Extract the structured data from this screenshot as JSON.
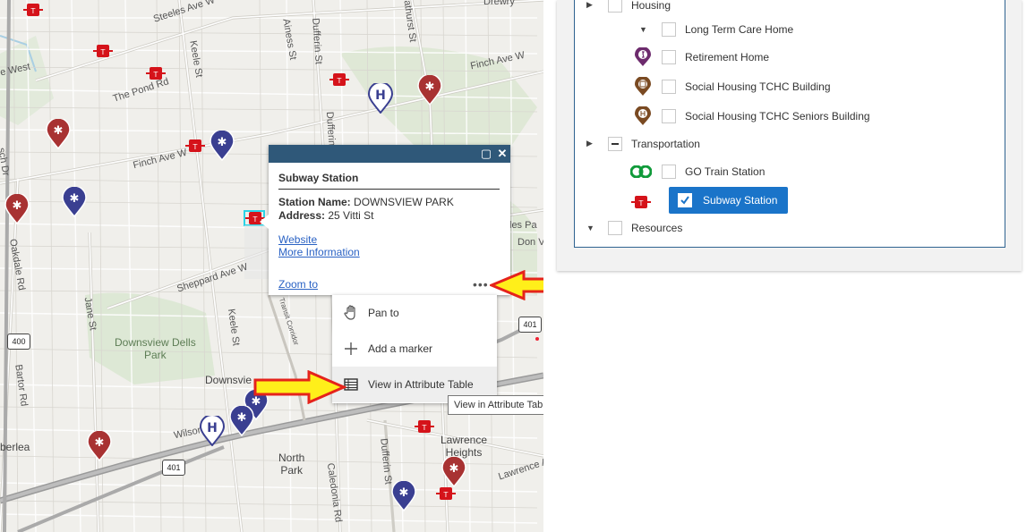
{
  "map": {
    "streets": {
      "steeles": "Steeles Ave W",
      "keele_top": "Keele St",
      "ainess": "Ainess St",
      "dufferin_top": "Dufferin St",
      "bathurst": "Bathurst St",
      "drewry": "Drewry",
      "finch_e": "Finch Ave W",
      "finch_w": "Finch Ave W",
      "pond": "The Pond Rd",
      "west": "e West",
      "oakdale": "Oakdale Rd",
      "jane": "Jane St",
      "sheppard": "Sheppard Ave W",
      "keele_mid": "Keele St",
      "dufferin_mid": "Dufferin",
      "wilson": "Wilson",
      "bartor": "Bartor Rd",
      "caledonia": "Caledonia Rd",
      "dufferin_bot": "Dufferin St",
      "lawrence": "Lawrence Ave W",
      "don_v": "Don V",
      "les_pa": "les Pa",
      "berlea": "berlea",
      "sth_dr": "sch Dr",
      "downsview": "Downsvie",
      "transit": "Transit Corridor"
    },
    "places": {
      "downsview_dells": "Downsview Dells",
      "park": "Park",
      "north": "North",
      "north_park": "Park",
      "lawrence": "Lawrence",
      "heights": "Heights"
    },
    "highways": [
      "400",
      "401",
      "401"
    ],
    "colors": {
      "hospital": "#a83232",
      "clinic": "#3a3f91",
      "ttc": "#d5131a",
      "water": "#a9cfe3",
      "park": "#d7e4cf"
    }
  },
  "popup": {
    "title": "Subway Station",
    "fields": [
      {
        "label": "Station Name:",
        "value": "DOWNSVIEW PARK"
      },
      {
        "label": "Address:",
        "value": "25 Vitti St"
      }
    ],
    "links": {
      "website": "Website",
      "more_info": "More Information ",
      "zoom": "Zoom to"
    },
    "more_dots": "•••",
    "maximize_icon": "maximize-icon",
    "close_icon": "close-icon"
  },
  "menu": {
    "items": [
      {
        "label": "Pan to",
        "icon": "hand-icon"
      },
      {
        "label": "Add a marker",
        "icon": "plus-icon"
      },
      {
        "label": "View in Attribute Table",
        "icon": "table-icon"
      }
    ],
    "tooltip": "View in Attribute Table"
  },
  "layers": {
    "items": [
      {
        "label": "Housing",
        "type": "group",
        "state": "unchecked",
        "expanded": false
      },
      {
        "label": "Long Term Care Home",
        "type": "layer",
        "state": "unchecked",
        "icon": "caret-down"
      },
      {
        "label": "Retirement Home",
        "type": "layer",
        "state": "unchecked",
        "icon": "retirement-icon",
        "color": "#6d2b6d"
      },
      {
        "label": "Social Housing TCHC Building",
        "type": "layer",
        "state": "unchecked",
        "icon": "tchc-icon",
        "color": "#7a4a22"
      },
      {
        "label": "Social Housing TCHC Seniors Building",
        "type": "layer",
        "state": "unchecked",
        "icon": "tchc-seniors-icon",
        "color": "#7a4a22"
      },
      {
        "label": "Transportation",
        "type": "group",
        "state": "partial",
        "expanded": false
      },
      {
        "label": "GO Train Station",
        "type": "layer",
        "state": "unchecked",
        "icon": "go-train-icon",
        "color": "#109a3a"
      },
      {
        "label": "Subway Station",
        "type": "layer",
        "state": "checked",
        "selected": true,
        "icon": "ttc-icon",
        "color": "#d5131a"
      },
      {
        "label": "Resources",
        "type": "group",
        "state": "unchecked",
        "expanded": true
      }
    ]
  }
}
